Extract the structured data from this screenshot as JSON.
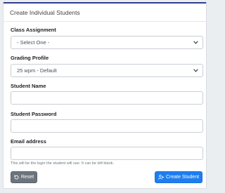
{
  "card": {
    "title": "Create Individual Students"
  },
  "form": {
    "class_assignment": {
      "label": "Class Assignment",
      "selected": "- Select One -"
    },
    "grading_profile": {
      "label": "Grading Profile",
      "selected": "25 wpm - Default"
    },
    "student_name": {
      "label": "Student Name",
      "value": "",
      "placeholder": ""
    },
    "student_password": {
      "label": "Student Password",
      "value": "",
      "placeholder": ""
    },
    "email": {
      "label": "Email address",
      "value": "",
      "placeholder": "",
      "help": "This will be the login the student will use. It can be left blank."
    }
  },
  "buttons": {
    "reset_label": "Reset",
    "create_label": "Create Student"
  },
  "icons": {
    "reset": "undo-icon",
    "create": "user-plus-icon",
    "select": "chevron-down-icon"
  },
  "colors": {
    "primary": "#1e7ef0",
    "secondary": "#6c757d",
    "header_accent": "#2d3e8f"
  }
}
